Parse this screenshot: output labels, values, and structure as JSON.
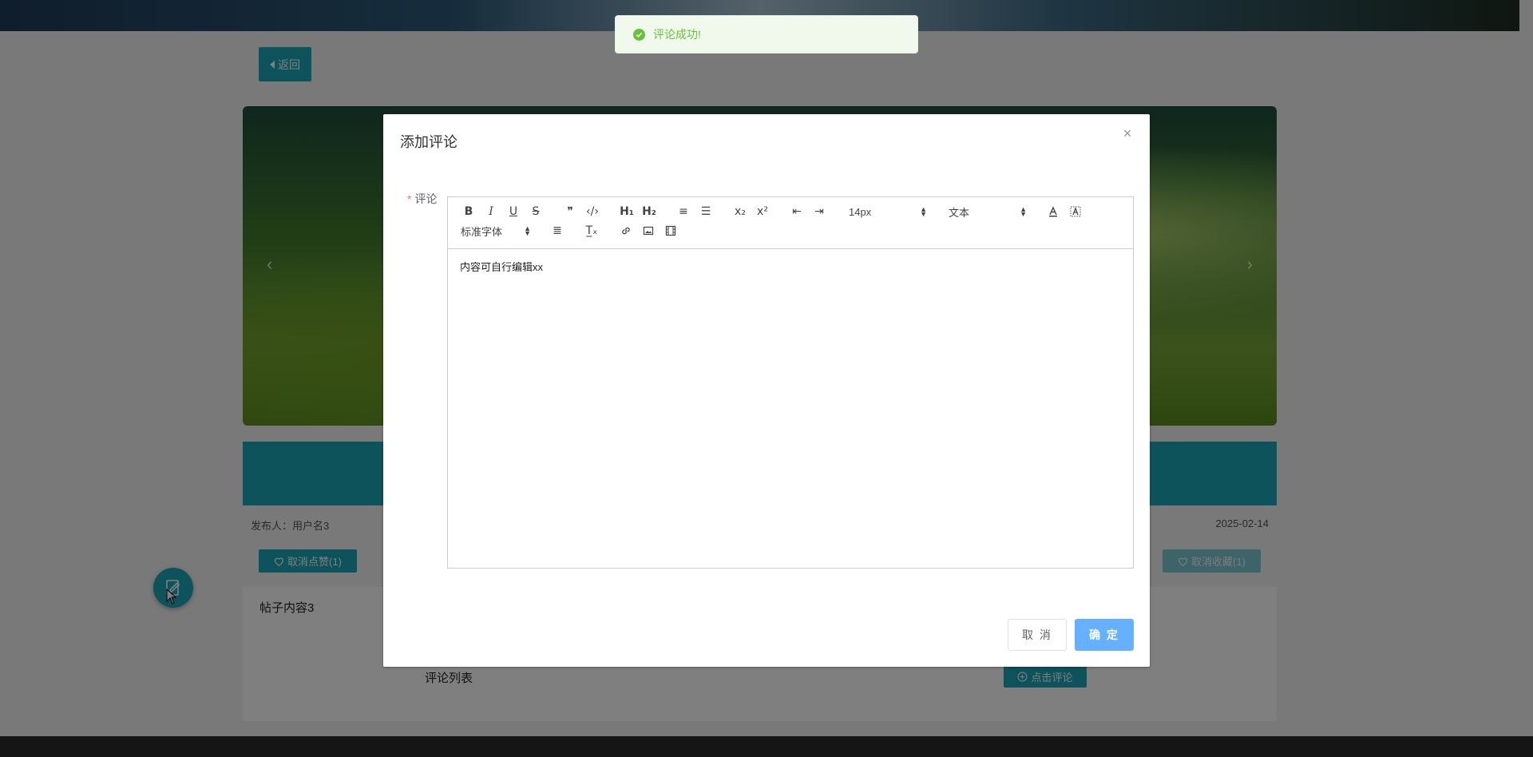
{
  "page": {
    "back_label": "返回",
    "publisher": "发布人：用户名3",
    "publish_date": "2025-02-14",
    "like_label": "取消点赞(1)",
    "favorite_label": "取消收藏(1)",
    "post_content": "帖子内容3",
    "comment_list_title": "评论列表",
    "click_comment_label": "点击评论"
  },
  "toast": {
    "message": "评论成功!"
  },
  "dialog": {
    "title": "添加评论",
    "close_icon": "×",
    "field_label": "评论",
    "required_mark": "*",
    "editor": {
      "toolbar": {
        "bold": "B",
        "italic": "I",
        "underline": "U",
        "strike": "S",
        "blockquote": "❞",
        "code": "‹/›",
        "h1": "H₁",
        "h2": "H₂",
        "ordered_list": "≡",
        "bullet_list": "☰",
        "subscript": "x₂",
        "superscript": "x²",
        "outdent": "⇤",
        "indent": "⇥",
        "size_value": "14px",
        "header_value": "文本",
        "font_value": "标准字体",
        "align": "≣",
        "clean": "T̲ₓ"
      },
      "content": "内容可自行编辑xx"
    },
    "cancel_label": "取 消",
    "confirm_label": "确 定"
  },
  "colors": {
    "primary": "#1aa6b7",
    "confirm": "#66b1ff",
    "success": "#67c23a",
    "required": "#f56c6c"
  }
}
